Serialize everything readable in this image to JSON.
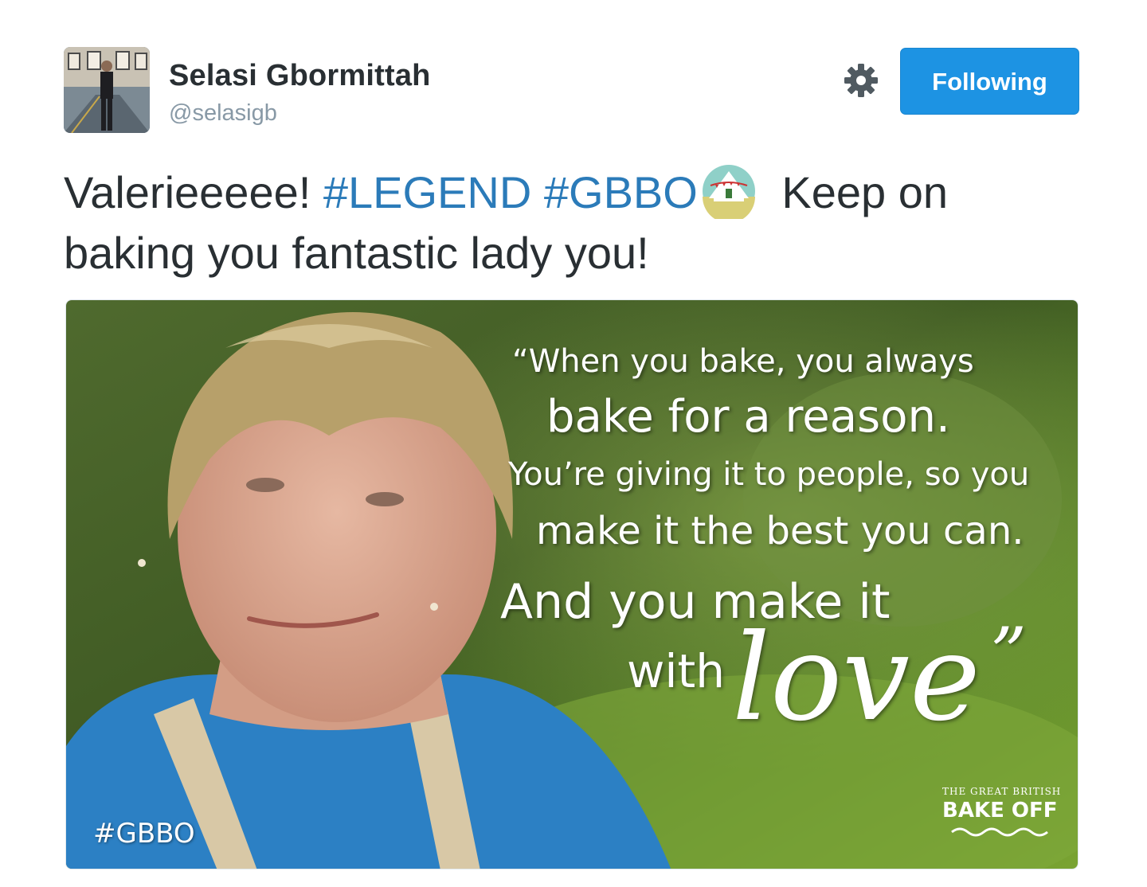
{
  "user": {
    "name": "Selasi Gbormittah",
    "screen_name": "@selasigb"
  },
  "actions": {
    "settings_icon": "gear-icon",
    "follow_label": "Following"
  },
  "tweet": {
    "text_start": "Valerieeeee! ",
    "hashtag_1": "#LEGEND",
    "hashtag_2": "#GBBO",
    "emoji": "circus-tent-emoji",
    "text_end": " Keep on baking you fantastic lady you!"
  },
  "media": {
    "quote_lines": [
      "“When you bake, you always",
      "bake for a reason.",
      "You’re giving it to people, so you",
      "make it the best you can.",
      "And you make it",
      "with",
      "love",
      "”"
    ],
    "hashtag": "#GBBO",
    "logo_small": "THE GREAT BRITISH",
    "logo_big": "BAKE OFF"
  },
  "colors": {
    "accent": "#1d93e3",
    "hashtag": "#2b7bb9",
    "muted": "#8899a6",
    "text": "#292f33"
  }
}
